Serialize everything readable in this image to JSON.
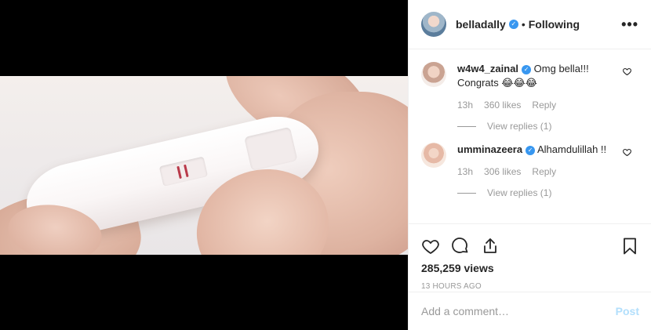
{
  "post": {
    "owner": {
      "username": "belladally",
      "verified": true,
      "follow_state": "Following",
      "separator": "•"
    },
    "more_label": "•••",
    "comments": [
      {
        "username": "w4w4_zainal",
        "verified": true,
        "text": "Omg bella!!! Congrats 😂😂😂",
        "time": "13h",
        "likes": "360 likes",
        "reply_label": "Reply",
        "view_replies": "View replies (1)"
      },
      {
        "username": "umminazeera",
        "verified": true,
        "text": "Alhamdulillah !!",
        "time": "13h",
        "likes": "306 likes",
        "reply_label": "Reply",
        "view_replies": "View replies (1)"
      }
    ],
    "views": "285,259 views",
    "time_ago": "13 HOURS AGO",
    "comment_input": {
      "placeholder": "Add a comment…",
      "value": ""
    },
    "post_label": "Post"
  },
  "icons": {
    "comment_like": "heart-outline-icon",
    "like": "heart-icon",
    "comment": "comment-bubble-icon",
    "share": "share-icon",
    "save": "bookmark-icon",
    "verified": "verified-badge-icon",
    "more": "more-options-icon"
  },
  "colors": {
    "verified": "#3897f0",
    "muted": "#999999",
    "post_disabled": "#b2dffc",
    "border": "#efefef"
  }
}
